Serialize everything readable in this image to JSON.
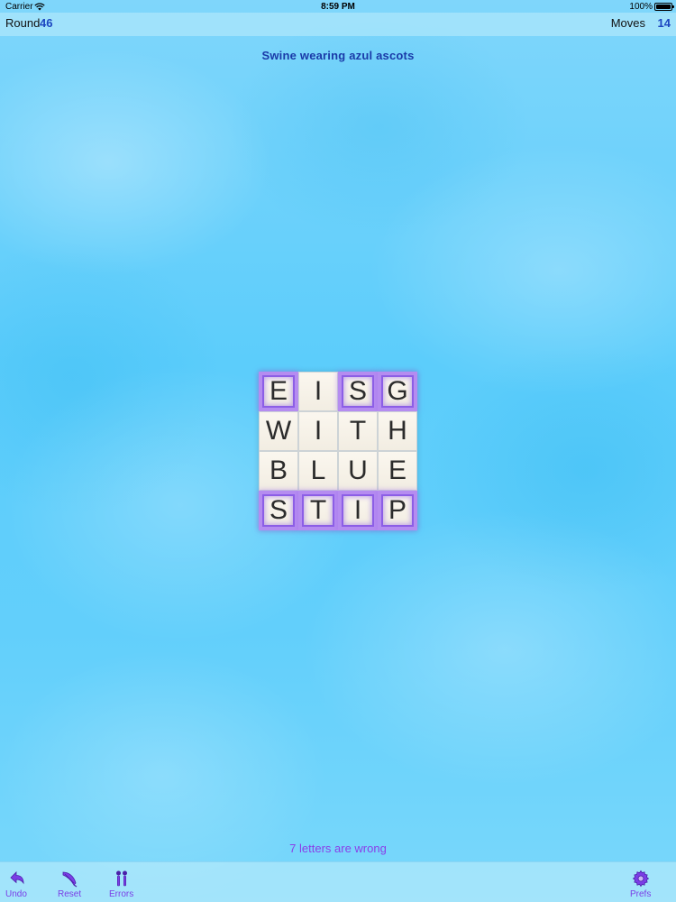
{
  "status_bar": {
    "carrier": "Carrier",
    "time": "8:59 PM",
    "battery": "100%"
  },
  "header": {
    "round_label": "Round",
    "round_value": "46",
    "moves_label": "Moves",
    "moves_value": "14"
  },
  "clue": "Swine wearing azul ascots",
  "board": {
    "rows": [
      [
        {
          "letter": "E",
          "wrong": true
        },
        {
          "letter": "I",
          "wrong": false
        },
        {
          "letter": "S",
          "wrong": true
        },
        {
          "letter": "G",
          "wrong": true
        }
      ],
      [
        {
          "letter": "W",
          "wrong": false
        },
        {
          "letter": "I",
          "wrong": false
        },
        {
          "letter": "T",
          "wrong": false
        },
        {
          "letter": "H",
          "wrong": false
        }
      ],
      [
        {
          "letter": "B",
          "wrong": false
        },
        {
          "letter": "L",
          "wrong": false
        },
        {
          "letter": "U",
          "wrong": false
        },
        {
          "letter": "E",
          "wrong": false
        }
      ],
      [
        {
          "letter": "S",
          "wrong": true
        },
        {
          "letter": "T",
          "wrong": true
        },
        {
          "letter": "I",
          "wrong": true
        },
        {
          "letter": "P",
          "wrong": true
        }
      ]
    ]
  },
  "status_message": "7 letters are wrong",
  "toolbar": {
    "undo": {
      "label": "Undo",
      "icon": "undo-arrow-icon"
    },
    "reset": {
      "label": "Reset",
      "icon": "reset-feather-icon"
    },
    "errors": {
      "label": "Errors",
      "icon": "errors-icon"
    },
    "prefs": {
      "label": "Prefs",
      "icon": "gear-icon"
    }
  },
  "colors": {
    "accent": "#8a3ee8",
    "header_value": "#1c46c0",
    "clue": "#1a3aa8",
    "wrong_outline": "#b58cf0"
  }
}
